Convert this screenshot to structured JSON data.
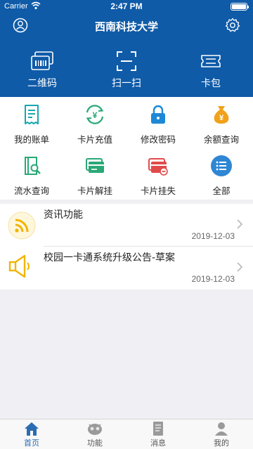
{
  "status_bar": {
    "carrier": "Carrier",
    "time": "2:47 PM"
  },
  "nav": {
    "title": "西南科技大学"
  },
  "quick_actions": [
    {
      "label": "二维码",
      "icon": "qr-code-icon"
    },
    {
      "label": "扫一扫",
      "icon": "scan-icon"
    },
    {
      "label": "卡包",
      "icon": "card-wallet-icon"
    }
  ],
  "grid": [
    {
      "label": "我的账单",
      "icon": "bill-icon"
    },
    {
      "label": "卡片充值",
      "icon": "recharge-icon"
    },
    {
      "label": "修改密码",
      "icon": "lock-icon"
    },
    {
      "label": "余额查询",
      "icon": "money-bag-icon"
    },
    {
      "label": "流水查询",
      "icon": "book-search-icon"
    },
    {
      "label": "卡片解挂",
      "icon": "card-unlock-icon"
    },
    {
      "label": "卡片挂失",
      "icon": "card-lost-icon"
    },
    {
      "label": "全部",
      "icon": "all-menu-icon"
    }
  ],
  "news": [
    {
      "title": "资讯功能",
      "date": "2019-12-03",
      "icon": "rss-icon"
    },
    {
      "title": "校园一卡通系统升级公告-草案",
      "date": "2019-12-03",
      "icon": "megaphone-icon"
    }
  ],
  "tabs": [
    {
      "label": "首页",
      "icon": "home-icon",
      "active": true
    },
    {
      "label": "功能",
      "icon": "robot-icon",
      "active": false
    },
    {
      "label": "消息",
      "icon": "message-icon",
      "active": false
    },
    {
      "label": "我的",
      "icon": "profile-icon",
      "active": false
    }
  ],
  "colors": {
    "header_blue": "#0f5ba8",
    "icon_teal": "#17a7b0",
    "icon_blue": "#1e88d6",
    "icon_orange": "#f0a21b",
    "icon_green": "#2aa876",
    "icon_red": "#e14b4b",
    "tab_active": "#2b6cb3"
  }
}
